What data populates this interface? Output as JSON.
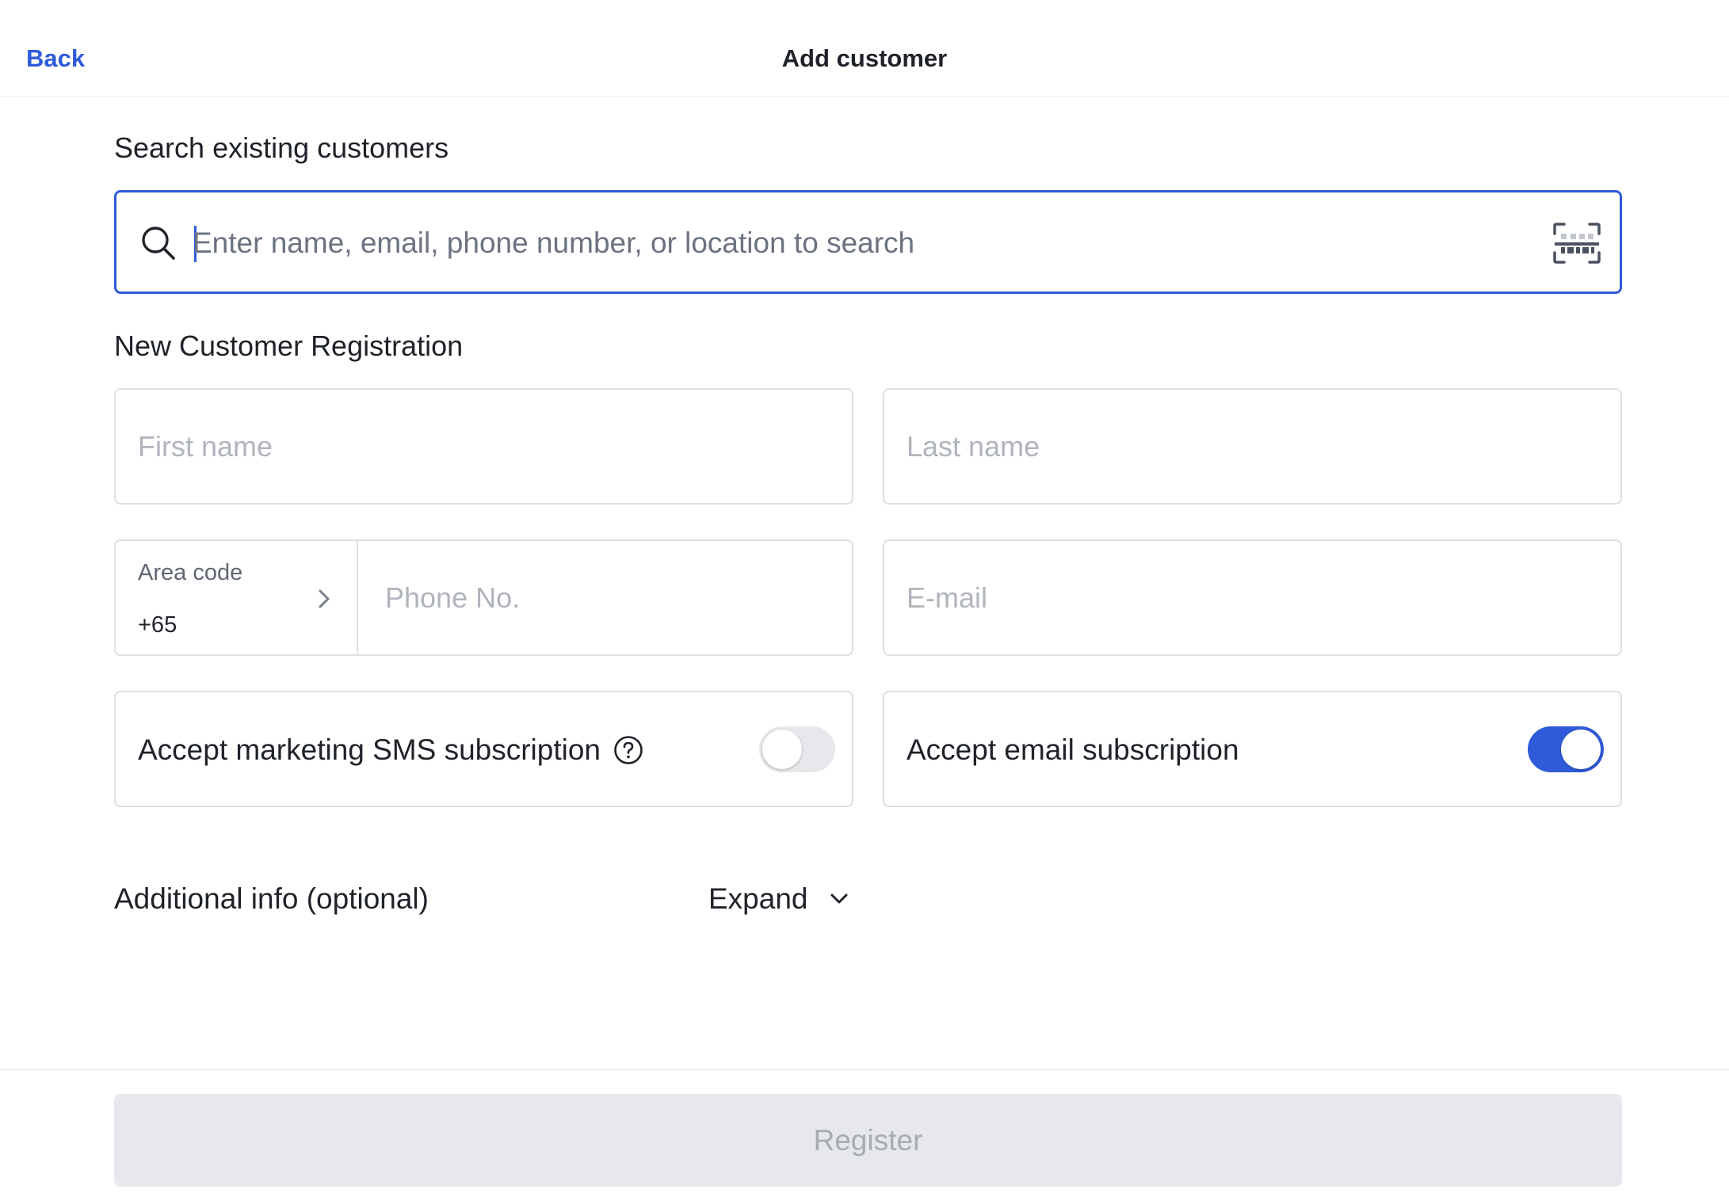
{
  "header": {
    "back_label": "Back",
    "title": "Add customer"
  },
  "search": {
    "section_title": "Search existing customers",
    "placeholder": "Enter name, email, phone number, or location to search",
    "value": ""
  },
  "registration": {
    "section_title": "New Customer Registration",
    "first_name_placeholder": "First name",
    "last_name_placeholder": "Last name",
    "area_code_label": "Area code",
    "area_code_value": "+65",
    "phone_placeholder": "Phone No.",
    "email_placeholder": "E-mail",
    "sms_subscription_label": "Accept marketing SMS subscription",
    "sms_subscription_on": false,
    "email_subscription_label": "Accept email subscription",
    "email_subscription_on": true
  },
  "additional": {
    "label": "Additional info (optional)",
    "expand_label": "Expand"
  },
  "footer": {
    "register_label": "Register"
  },
  "colors": {
    "accent": "#2f5ad9",
    "disabled_bg": "#e6e8ec",
    "disabled_text": "#a7abb3"
  }
}
